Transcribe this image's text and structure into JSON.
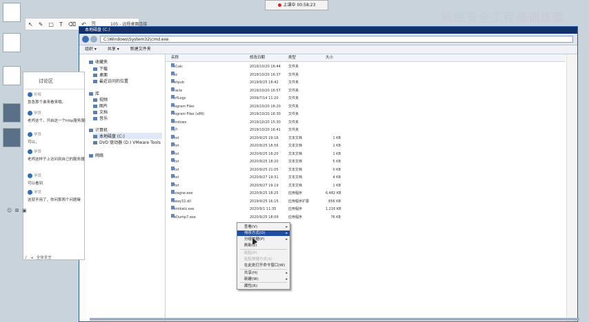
{
  "recording": {
    "label": "上课中 00:58:23"
  },
  "annotation_toolbar": {
    "tools": [
      "↖",
      "✎",
      "▢",
      "T",
      "⌫",
      "↶",
      "⎘"
    ]
  },
  "outer_window_title": "105 - 远程桌面连接",
  "watermark": "网络安全工程师训练营",
  "chat": {
    "title": "讨论区",
    "messages": [
      {
        "name": "孙辉",
        "text": "急急那个谁来看来哦。"
      },
      {
        "name": "学员",
        "text": "老师这个，开启这一个http服务服务"
      },
      {
        "name": "学员",
        "text": "可以，"
      },
      {
        "name": "学员",
        "text": "老师这样子上访问到自己的服务器"
      },
      {
        "name": "学员",
        "text": "可以看到"
      },
      {
        "name": "学员",
        "text": "这就不用了，你问那两个问题嘛"
      }
    ],
    "footer": "全体发言"
  },
  "explorer": {
    "title": "本地磁盘 (C:)",
    "address": "C:\\Windows\\System32\\cmd.exe",
    "toolbar": [
      "组织 ▾",
      "共享 ▾",
      "新建文件夹"
    ],
    "nav": {
      "favorites": "收藏夹",
      "downloads": "下载",
      "desktop": "桌面",
      "recent": "最近访问的位置",
      "libraries": "库",
      "videos": "视频",
      "pictures": "图片",
      "documents": "文档",
      "music": "音乐",
      "computer": "计算机",
      "local_disk": "本地磁盘 (C:)",
      "dvd": "DVD 驱动器 (D:) VMware Tools",
      "network": "网络"
    },
    "columns": {
      "name": "名称",
      "date": "修改日期",
      "type": "类型",
      "size": "大小"
    },
    "files": [
      {
        "name": "NsCalc",
        "date": "2019/10/20 16:44",
        "type": "文件夹",
        "size": ""
      },
      {
        "name": "hex",
        "date": "2019/10/20 16:37",
        "type": "文件夹",
        "size": ""
      },
      {
        "name": "inetpub",
        "date": "2019/9/25 18:42",
        "type": "文件夹",
        "size": ""
      },
      {
        "name": "Oracle",
        "date": "2019/10/20 16:57",
        "type": "文件夹",
        "size": ""
      },
      {
        "name": "PerfLogs",
        "date": "2009/7/14 11:20",
        "type": "文件夹",
        "size": ""
      },
      {
        "name": "Program Files",
        "date": "2019/10/20 16:20",
        "type": "文件夹",
        "size": ""
      },
      {
        "name": "Program Files (x86)",
        "date": "2019/10/20 16:30",
        "type": "文件夹",
        "size": ""
      },
      {
        "name": "Windows",
        "date": "2019/10/20 15:30",
        "type": "文件夹",
        "size": ""
      },
      {
        "name": "用户",
        "date": "2019/10/20 16:41",
        "type": "文件夹",
        "size": ""
      },
      {
        "name": "1.txt",
        "date": "2020/9/25 19:16",
        "type": "文本文档",
        "size": "1 KB"
      },
      {
        "name": "2.txt",
        "date": "2020/9/25 18:56",
        "type": "文本文档",
        "size": "1 KB"
      },
      {
        "name": "3.txt",
        "date": "2020/9/25 18:20",
        "type": "文本文档",
        "size": "1 KB"
      },
      {
        "name": "4.txt",
        "date": "2020/9/25 18:20",
        "type": "文本文档",
        "size": "5 KB"
      },
      {
        "name": "6.txt",
        "date": "2020/9/25 21:05",
        "type": "文本文档",
        "size": "0 KB"
      },
      {
        "name": "a.txt",
        "date": "2020/9/27 19:31",
        "type": "文本文档",
        "size": "4 KB"
      },
      {
        "name": "b.txt",
        "date": "2020/9/27 19:19",
        "type": "文本文档",
        "size": "1 KB"
      },
      {
        "name": "Lazagne.exe",
        "date": "2020/9/25 18:25",
        "type": "应用程序",
        "size": "6,482 KB"
      },
      {
        "name": "libeay32.dll",
        "date": "2019/9/25 16:15",
        "type": "应用程序扩展",
        "size": "856 KB"
      },
      {
        "name": "mimikatz.exe",
        "date": "2020/9/1 11:35",
        "type": "应用程序",
        "size": "1,216 KB"
      },
      {
        "name": "PwDump7.exe",
        "date": "2020/9/25 18:09",
        "type": "应用程序",
        "size": "76 KB"
      }
    ]
  },
  "context_menu": {
    "items": [
      {
        "label": "查看(V)",
        "submenu": true,
        "state": "normal"
      },
      {
        "label": "排序方式(O)",
        "submenu": true,
        "state": "highlight"
      },
      {
        "label": "分组依据(P)",
        "submenu": true,
        "state": "normal"
      },
      {
        "label": "刷新(E)",
        "submenu": false,
        "state": "normal"
      },
      {
        "label": "粘贴(P)",
        "submenu": false,
        "state": "disabled"
      },
      {
        "label": "粘贴快捷方式(S)",
        "submenu": false,
        "state": "disabled"
      },
      {
        "label": "在此处打开命令窗口(W)",
        "submenu": false,
        "state": "normal"
      },
      {
        "label": "共享(H)",
        "submenu": true,
        "state": "normal"
      },
      {
        "label": "新建(W)",
        "submenu": true,
        "state": "normal"
      },
      {
        "label": "属性(R)",
        "submenu": false,
        "state": "normal"
      }
    ]
  }
}
